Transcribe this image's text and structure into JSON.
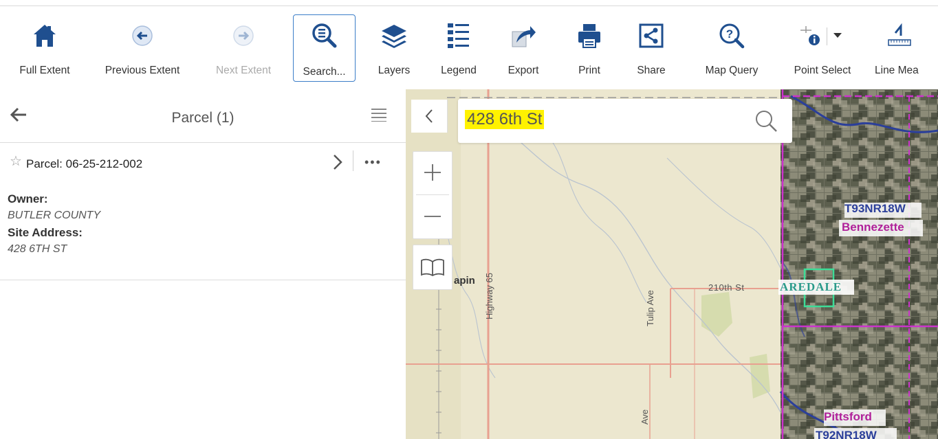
{
  "toolbar": {
    "items": [
      {
        "label": "Full Extent",
        "icon": "home-icon"
      },
      {
        "label": "Previous Extent",
        "icon": "previous-extent-icon"
      },
      {
        "label": "Next Extent",
        "icon": "next-extent-icon",
        "disabled": true
      },
      {
        "label": "Search...",
        "icon": "search-list-icon",
        "active": true
      },
      {
        "label": "Layers",
        "icon": "layers-icon"
      },
      {
        "label": "Legend",
        "icon": "legend-icon"
      },
      {
        "label": "Export",
        "icon": "export-icon"
      },
      {
        "label": "Print",
        "icon": "print-icon"
      },
      {
        "label": "Share",
        "icon": "share-icon"
      },
      {
        "label": "Map Query",
        "icon": "map-query-icon"
      },
      {
        "label": "Point Select",
        "icon": "point-select-icon"
      },
      {
        "label": "Line Mea",
        "icon": "line-measure-icon"
      }
    ],
    "accent_color": "#1f4f8f",
    "active_border_color": "#3b7dc8"
  },
  "panel": {
    "title": "Parcel (1)",
    "result": {
      "title": "Parcel: 06-25-212-002",
      "more_glyph": "•••",
      "attributes": [
        {
          "label": "Owner:",
          "value": "BUTLER COUNTY"
        },
        {
          "label": "Site Address:",
          "value": "428 6TH ST"
        }
      ]
    }
  },
  "map": {
    "search": {
      "value": "428 6th St",
      "highlight_color": "#fff200"
    },
    "labels": {
      "township_1": "T93NR18W",
      "place_1": "Bennezette",
      "place_2": "AREDALE",
      "place_3": "Pittsford",
      "township_2": "T92NR18W",
      "road_1": "210th St",
      "road_2": "Tulip Ave",
      "road_3": "Highway 65",
      "road_4": "Ave",
      "place_4": "apin"
    },
    "colors": {
      "base": "#ebe6cc",
      "road": "#e8a090",
      "township_line": "#cc33cc",
      "river": "#2b3f9a",
      "town_box": "#3ddc97"
    }
  }
}
